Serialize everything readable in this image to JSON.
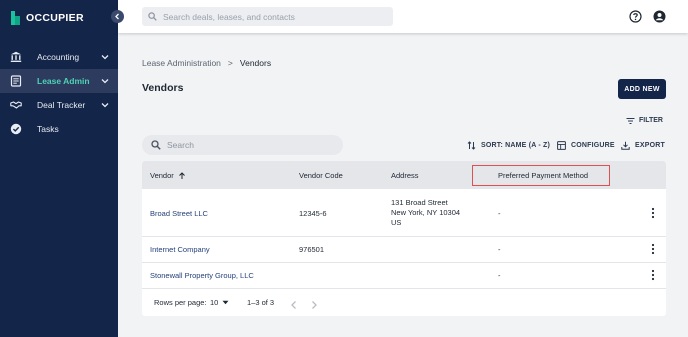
{
  "app": {
    "logo_text": "OCCUPIER"
  },
  "sidebar": {
    "items": [
      {
        "label": "Accounting",
        "icon": "bank-icon",
        "has_chevron": true,
        "active": false
      },
      {
        "label": "Lease Admin",
        "icon": "document-icon",
        "has_chevron": true,
        "active": true
      },
      {
        "label": "Deal Tracker",
        "icon": "handshake-icon",
        "has_chevron": true,
        "active": false
      },
      {
        "label": "Tasks",
        "icon": "check-circle-icon",
        "has_chevron": false,
        "active": false
      }
    ]
  },
  "topbar": {
    "search_placeholder": "Search deals, leases, and contacts"
  },
  "breadcrumb": {
    "parent": "Lease Administration",
    "separator": ">",
    "current": "Vendors"
  },
  "page": {
    "title": "Vendors",
    "add_new_label": "ADD NEW",
    "filter_label": "FILTER"
  },
  "toolbar": {
    "search_placeholder": "Search",
    "sort_label": "SORT: NAME (A - Z)",
    "configure_label": "CONFIGURE",
    "export_label": "EXPORT"
  },
  "table": {
    "columns": [
      "Vendor",
      "Vendor Code",
      "Address",
      "Preferred Payment Method"
    ],
    "rows": [
      {
        "vendor": "Broad Street LLC",
        "code": "12345-6",
        "address": [
          "131 Broad Street",
          "New York, NY 10304",
          "US"
        ],
        "payment": "-"
      },
      {
        "vendor": "Internet Company",
        "code": "976501",
        "address": [],
        "payment": "-"
      },
      {
        "vendor": "Stonewall Property Group, LLC",
        "code": "",
        "address": [],
        "payment": "-"
      }
    ]
  },
  "pagination": {
    "rows_per_page_label": "Rows per page:",
    "rows_per_page": "10",
    "range": "1–3 of 3"
  },
  "colors": {
    "sidebar_bg": "#14254a",
    "accent": "#4fd3b4",
    "highlight": "#e05050",
    "link": "#25417a"
  }
}
